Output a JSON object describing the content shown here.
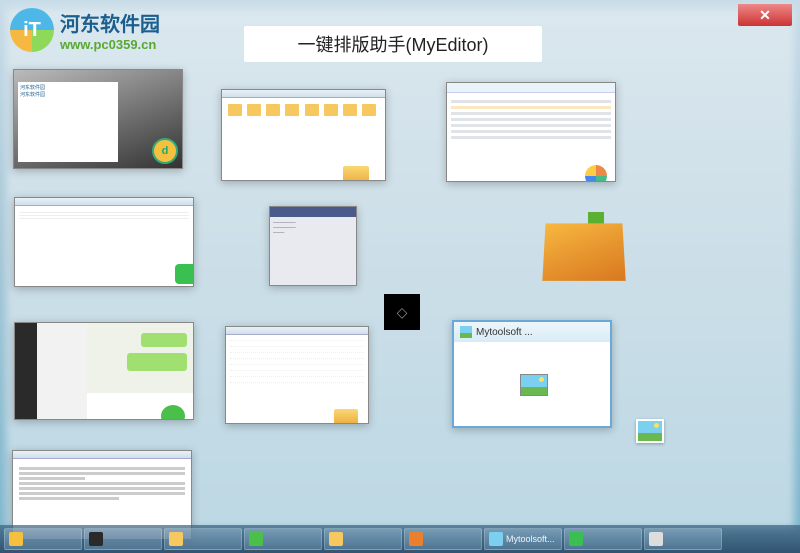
{
  "header": {
    "logo_name": "河东软件园",
    "logo_url": "www.pc0359.cn",
    "title": "一键排版助手(MyEditor)"
  },
  "close_label": "✕",
  "windows": {
    "t1_brand1": "河东软件园",
    "t1_brand2": "河东软件园",
    "t8_title": "Mytoolsoft ..."
  },
  "taskbar": {
    "items": [
      {
        "label": ""
      },
      {
        "label": ""
      },
      {
        "label": ""
      },
      {
        "label": ""
      },
      {
        "label": ""
      },
      {
        "label": ""
      },
      {
        "label": "Mytoolsoft..."
      },
      {
        "label": ""
      },
      {
        "label": ""
      }
    ]
  }
}
